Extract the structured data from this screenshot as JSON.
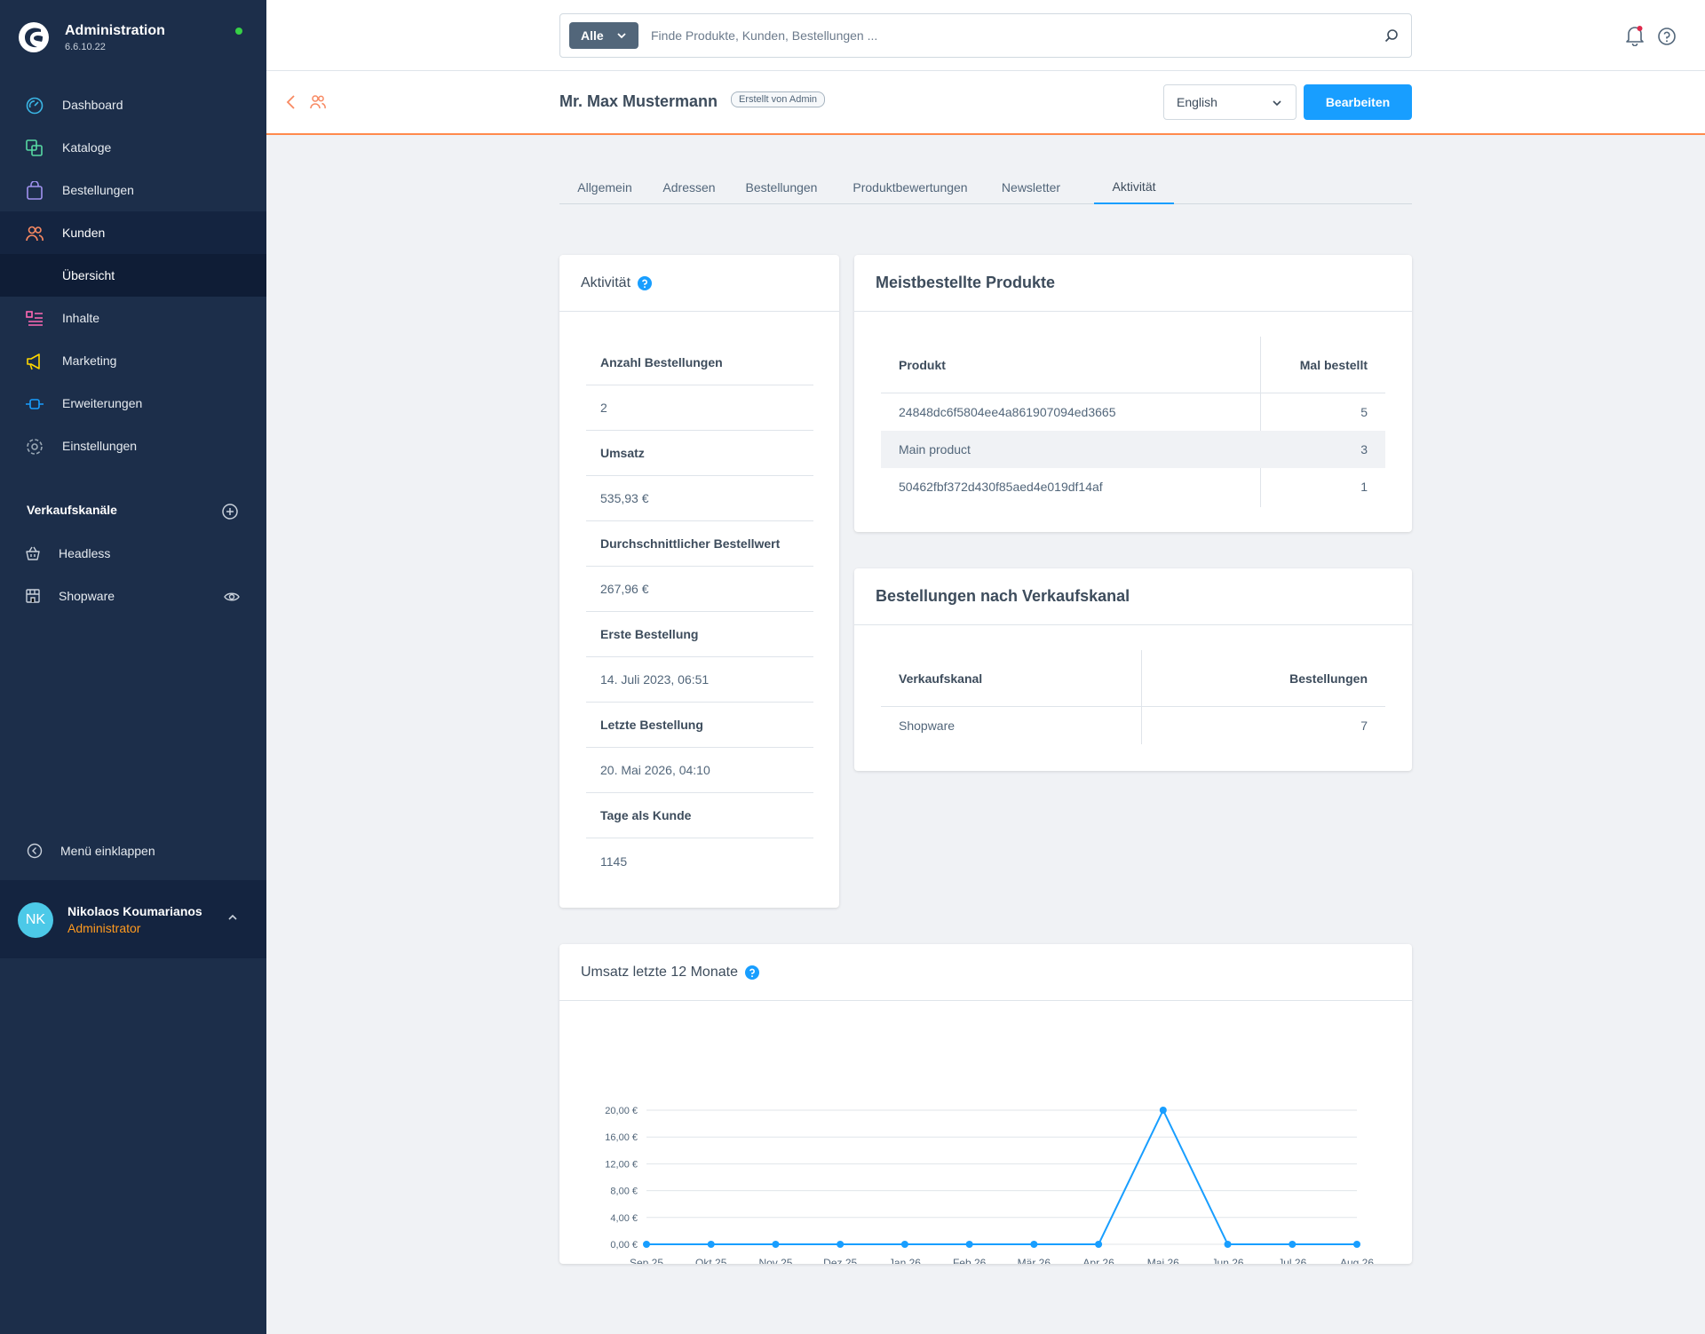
{
  "app": {
    "title": "Administration",
    "version": "6.6.10.22"
  },
  "nav": {
    "items": [
      {
        "label": "Dashboard",
        "icon": "dashboard-icon",
        "color": "#3ab6e6"
      },
      {
        "label": "Kataloge",
        "icon": "catalog-icon",
        "color": "#57d9a3"
      },
      {
        "label": "Bestellungen",
        "icon": "orders-icon",
        "color": "#a092f0"
      },
      {
        "label": "Kunden",
        "icon": "customers-icon",
        "color": "#f88962"
      },
      {
        "label": "Inhalte",
        "icon": "content-icon",
        "color": "#ff68b4"
      },
      {
        "label": "Marketing",
        "icon": "marketing-icon",
        "color": "#ffd700"
      },
      {
        "label": "Erweiterungen",
        "icon": "extensions-icon",
        "color": "#189eff"
      },
      {
        "label": "Einstellungen",
        "icon": "settings-icon",
        "color": "#9aa8b5"
      }
    ],
    "sub_item": "Übersicht",
    "channels_title": "Verkaufskanäle",
    "channels": [
      "Headless",
      "Shopware"
    ],
    "collapse_label": "Menü einklappen"
  },
  "user": {
    "initials": "NK",
    "name": "Nikolaos Koumarianos",
    "role": "Administrator"
  },
  "search": {
    "type": "Alle",
    "placeholder": "Finde Produkte, Kunden, Bestellungen ..."
  },
  "header": {
    "title": "Mr. Max Mustermann",
    "badge": "Erstellt von Admin",
    "language": "English",
    "edit_label": "Bearbeiten"
  },
  "tabs": [
    "Allgemein",
    "Adressen",
    "Bestellungen",
    "Produktbewertungen",
    "Newsletter",
    "Aktivität"
  ],
  "activity": {
    "title": "Aktivität",
    "rows": [
      {
        "label": "Anzahl Bestellungen",
        "value": "2"
      },
      {
        "label": "Umsatz",
        "value": "535,93 €"
      },
      {
        "label": "Durchschnittlicher Bestellwert",
        "value": "267,96 €"
      },
      {
        "label": "Erste Bestellung",
        "value": "14. Juli 2023, 06:51"
      },
      {
        "label": "Letzte Bestellung",
        "value": "20. Mai 2026, 04:10"
      },
      {
        "label": "Tage als Kunde",
        "value": "1145"
      }
    ]
  },
  "top_products": {
    "title": "Meistbestellte Produkte",
    "col_product": "Produkt",
    "col_count": "Mal bestellt",
    "rows": [
      {
        "product": "24848dc6f5804ee4a861907094ed3665",
        "count": "5"
      },
      {
        "product": "Main product",
        "count": "3"
      },
      {
        "product": "50462fbf372d430f85aed4e019df14af",
        "count": "1"
      }
    ]
  },
  "channel_orders": {
    "title": "Bestellungen nach Verkaufskanal",
    "col_channel": "Verkaufskanal",
    "col_orders": "Bestellungen",
    "rows": [
      {
        "channel": "Shopware",
        "orders": "7"
      }
    ]
  },
  "revenue": {
    "title": "Umsatz letzte 12 Monate"
  },
  "chart_data": {
    "type": "line",
    "categories": [
      "Sep 25",
      "Okt 25",
      "Nov 25",
      "Dez 25",
      "Jan 26",
      "Feb 26",
      "Mär 26",
      "Apr 26",
      "Mai 26",
      "Jun 26",
      "Jul 26",
      "Aug 26"
    ],
    "series": [
      {
        "values": [
          0,
          0,
          0,
          0,
          0,
          0,
          0,
          0,
          20,
          0,
          0,
          0
        ]
      }
    ],
    "y_ticks": [
      "0,00 €",
      "4,00 €",
      "8,00 €",
      "12,00 €",
      "16,00 €",
      "20,00 €"
    ],
    "ylim": [
      0,
      20
    ],
    "grid": true,
    "color": "#189eff"
  }
}
